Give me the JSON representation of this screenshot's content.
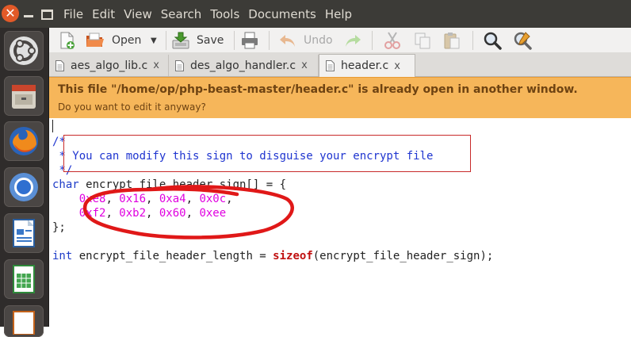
{
  "menu": {
    "items": [
      "File",
      "Edit",
      "View",
      "Search",
      "Tools",
      "Documents",
      "Help"
    ]
  },
  "toolbar": {
    "open_label": "Open",
    "save_label": "Save",
    "undo_label": "Undo"
  },
  "tabs": [
    {
      "label": "aes_algo_lib.c",
      "close": "x"
    },
    {
      "label": "des_algo_handler.c",
      "close": "x"
    },
    {
      "label": "header.c",
      "close": "x"
    }
  ],
  "infobar": {
    "title": "This file \"/home/op/php-beast-master/header.c\" is already open in another window.",
    "subtitle": "Do you want to edit it anyway?"
  },
  "code": {
    "l1": "/*",
    "l2": " * You can modify this sign to disguise your encrypt file",
    "l3": " */",
    "l4_kw": "char",
    "l4_rest": " encrypt_file_header_sign[] = {",
    "l5_indent": "    ",
    "l5_n1": "0xe8",
    "l5_s1": ", ",
    "l5_n2": "0x16",
    "l5_s2": ", ",
    "l5_n3": "0xa4",
    "l5_s3": ", ",
    "l5_n4": "0x0c",
    "l5_s4": ",",
    "l6_indent": "    ",
    "l6_n1": "0xf2",
    "l6_s1": ", ",
    "l6_n2": "0xb2",
    "l6_s2": ", ",
    "l6_n3": "0x60",
    "l6_s3": ", ",
    "l6_n4": "0xee",
    "l7": "};",
    "l9_kw": "int",
    "l9_mid": " encrypt_file_header_length = ",
    "l9_fn": "sizeof",
    "l9_end": "(encrypt_file_header_sign);"
  },
  "colors": {
    "menubar": "#3c3b37",
    "launcher": "#2f2c2b",
    "infobar": "#f6b65a",
    "comment": "#1f35d0",
    "keyword": "#1e3cc8",
    "number": "#e000e0",
    "function": "#c01010",
    "annotation": "#e01818"
  },
  "icons": [
    "close-icon",
    "minimize-icon",
    "maximize-icon",
    "ubuntu-dash-icon",
    "file-manager-icon",
    "firefox-icon",
    "chromium-icon",
    "libreoffice-writer-icon",
    "libreoffice-calc-icon",
    "libreoffice-impress-icon",
    "new-document-icon",
    "open-folder-icon",
    "dropdown-arrow-icon",
    "save-icon",
    "print-icon",
    "undo-icon",
    "redo-icon",
    "cut-icon",
    "copy-icon",
    "paste-icon",
    "search-icon",
    "search-replace-icon"
  ]
}
